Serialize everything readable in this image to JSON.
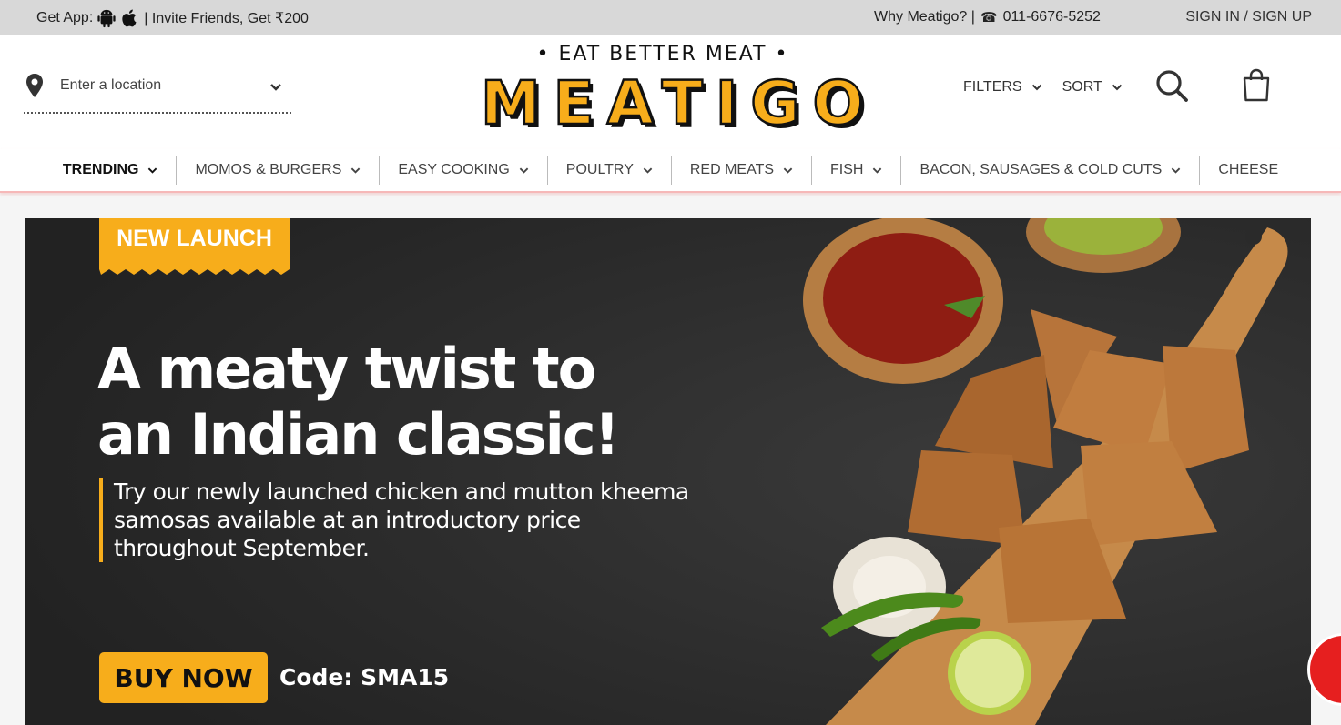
{
  "topbar": {
    "get_app": "Get App:",
    "invite": "| Invite Friends, Get ₹200",
    "why": "Why Meatigo? |",
    "phone": "011-6676-5252",
    "sign": "SIGN IN / SIGN UP"
  },
  "header": {
    "location_placeholder": "Enter a location",
    "tagline": "• EAT BETTER MEAT •",
    "brand": "MEATIGO",
    "filters": "FILTERS",
    "sort": "SORT"
  },
  "nav": {
    "items": [
      {
        "label": "TRENDING"
      },
      {
        "label": "MOMOS & BURGERS"
      },
      {
        "label": "EASY COOKING"
      },
      {
        "label": "POULTRY"
      },
      {
        "label": "RED MEATS"
      },
      {
        "label": "FISH"
      },
      {
        "label": "BACON, SAUSAGES & COLD CUTS"
      },
      {
        "label": "CHEESE"
      }
    ]
  },
  "banner": {
    "badge": "NEW LAUNCH",
    "headline_line1": "A meaty twist to",
    "headline_line2": "an Indian classic!",
    "sub_line1": "Try our newly launched chicken and mutton kheema",
    "sub_line2": "samosas available at an introductory price",
    "sub_line3": "throughout September.",
    "button": "BUY NOW",
    "code": "Code: SMA15"
  },
  "colors": {
    "accent": "#f7ad1b",
    "topbar_bg": "#d8d8d8",
    "banner_bg": "#2b2b2b",
    "chat_red": "#e61f1f"
  }
}
